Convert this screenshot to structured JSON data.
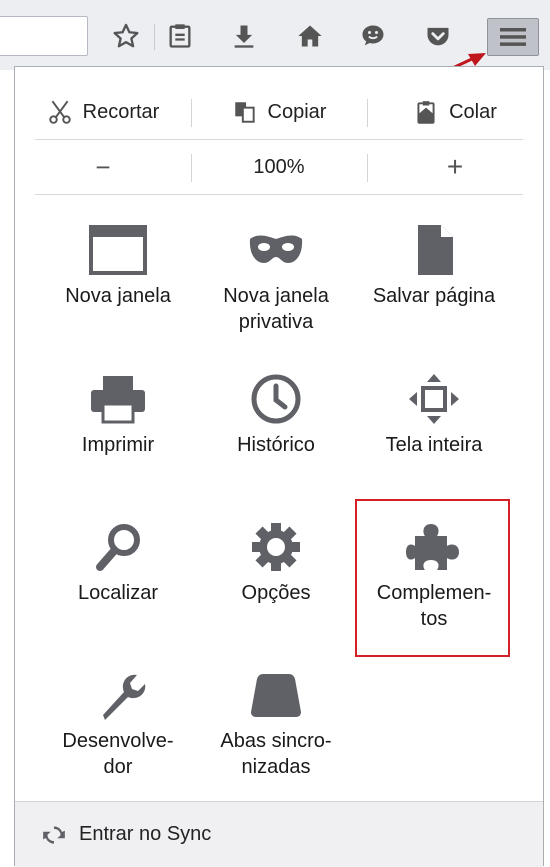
{
  "edit_row": {
    "cut_label": "Recortar",
    "copy_label": "Copiar",
    "paste_label": "Colar"
  },
  "zoom_row": {
    "zoom_out": "−",
    "zoom_level": "100%",
    "zoom_in": "+"
  },
  "grid": {
    "new_window": "Nova janela",
    "private_window_1": "Nova janela",
    "private_window_2": "privativa",
    "save_page": "Salvar página",
    "print": "Imprimir",
    "history": "Histórico",
    "fullscreen": "Tela inteira",
    "find": "Localizar",
    "options": "Opções",
    "addons_1": "Complemen-",
    "addons_2": "tos",
    "developer_1": "Desenvolve-",
    "developer_2": "dor",
    "synced_tabs_1": "Abas sincro-",
    "synced_tabs_2": "nizadas"
  },
  "footer": {
    "sync_label": "Entrar no Sync"
  },
  "colors": {
    "icon": "#5f6166",
    "highlight": "#d41f26",
    "arrow": "#c0161e"
  }
}
